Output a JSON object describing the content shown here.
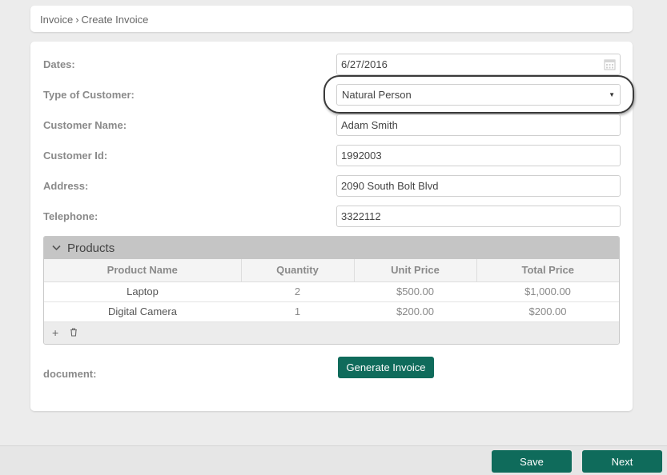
{
  "breadcrumb": {
    "parent": "Invoice",
    "separator": "›",
    "current": "Create Invoice"
  },
  "form": {
    "dates": {
      "label": "Dates:",
      "value": "6/27/2016"
    },
    "customer_type": {
      "label": "Type of Customer:",
      "value": "Natural Person"
    },
    "customer_name": {
      "label": "Customer Name:",
      "value": "Adam Smith"
    },
    "customer_id": {
      "label": "Customer Id:",
      "value": "1992003"
    },
    "address": {
      "label": "Address:",
      "value": "2090 South Bolt Blvd"
    },
    "telephone": {
      "label": "Telephone:",
      "value": "3322112"
    }
  },
  "products": {
    "title": "Products",
    "columns": [
      "Product Name",
      "Quantity",
      "Unit Price",
      "Total Price"
    ],
    "rows": [
      [
        "Laptop",
        "2",
        "$500.00",
        "$1,000.00"
      ],
      [
        "Digital Camera",
        "1",
        "$200.00",
        "$200.00"
      ]
    ],
    "add_label": "+"
  },
  "document": {
    "label": "document:"
  },
  "buttons": {
    "generate": "Generate Invoice",
    "save": "Save",
    "next": "Next"
  },
  "colors": {
    "primary": "#0f6b5b",
    "panel_header": "#c5c5c5"
  }
}
